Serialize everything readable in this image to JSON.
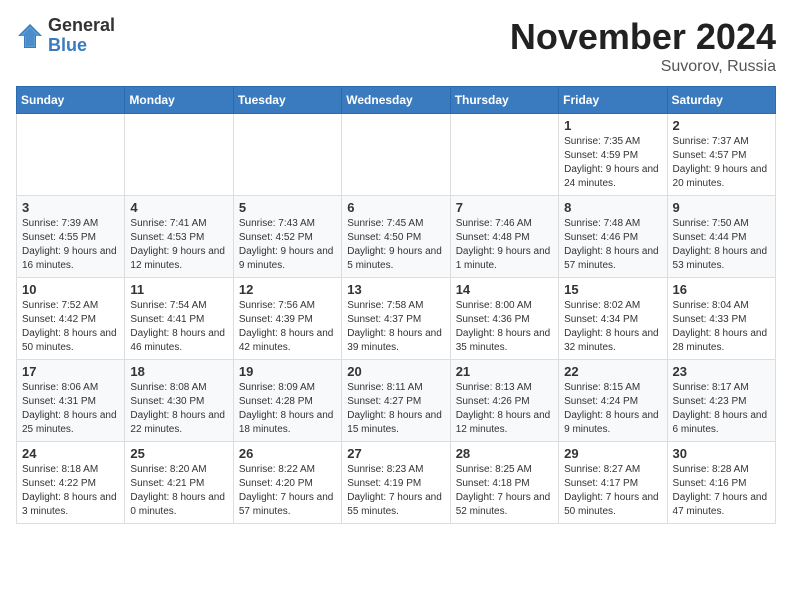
{
  "header": {
    "logo": {
      "general": "General",
      "blue": "Blue"
    },
    "title": "November 2024",
    "location": "Suvorov, Russia"
  },
  "calendar": {
    "weekdays": [
      "Sunday",
      "Monday",
      "Tuesday",
      "Wednesday",
      "Thursday",
      "Friday",
      "Saturday"
    ],
    "weeks": [
      [
        {
          "day": "",
          "info": ""
        },
        {
          "day": "",
          "info": ""
        },
        {
          "day": "",
          "info": ""
        },
        {
          "day": "",
          "info": ""
        },
        {
          "day": "",
          "info": ""
        },
        {
          "day": "1",
          "info": "Sunrise: 7:35 AM\nSunset: 4:59 PM\nDaylight: 9 hours and 24 minutes."
        },
        {
          "day": "2",
          "info": "Sunrise: 7:37 AM\nSunset: 4:57 PM\nDaylight: 9 hours and 20 minutes."
        }
      ],
      [
        {
          "day": "3",
          "info": "Sunrise: 7:39 AM\nSunset: 4:55 PM\nDaylight: 9 hours and 16 minutes."
        },
        {
          "day": "4",
          "info": "Sunrise: 7:41 AM\nSunset: 4:53 PM\nDaylight: 9 hours and 12 minutes."
        },
        {
          "day": "5",
          "info": "Sunrise: 7:43 AM\nSunset: 4:52 PM\nDaylight: 9 hours and 9 minutes."
        },
        {
          "day": "6",
          "info": "Sunrise: 7:45 AM\nSunset: 4:50 PM\nDaylight: 9 hours and 5 minutes."
        },
        {
          "day": "7",
          "info": "Sunrise: 7:46 AM\nSunset: 4:48 PM\nDaylight: 9 hours and 1 minute."
        },
        {
          "day": "8",
          "info": "Sunrise: 7:48 AM\nSunset: 4:46 PM\nDaylight: 8 hours and 57 minutes."
        },
        {
          "day": "9",
          "info": "Sunrise: 7:50 AM\nSunset: 4:44 PM\nDaylight: 8 hours and 53 minutes."
        }
      ],
      [
        {
          "day": "10",
          "info": "Sunrise: 7:52 AM\nSunset: 4:42 PM\nDaylight: 8 hours and 50 minutes."
        },
        {
          "day": "11",
          "info": "Sunrise: 7:54 AM\nSunset: 4:41 PM\nDaylight: 8 hours and 46 minutes."
        },
        {
          "day": "12",
          "info": "Sunrise: 7:56 AM\nSunset: 4:39 PM\nDaylight: 8 hours and 42 minutes."
        },
        {
          "day": "13",
          "info": "Sunrise: 7:58 AM\nSunset: 4:37 PM\nDaylight: 8 hours and 39 minutes."
        },
        {
          "day": "14",
          "info": "Sunrise: 8:00 AM\nSunset: 4:36 PM\nDaylight: 8 hours and 35 minutes."
        },
        {
          "day": "15",
          "info": "Sunrise: 8:02 AM\nSunset: 4:34 PM\nDaylight: 8 hours and 32 minutes."
        },
        {
          "day": "16",
          "info": "Sunrise: 8:04 AM\nSunset: 4:33 PM\nDaylight: 8 hours and 28 minutes."
        }
      ],
      [
        {
          "day": "17",
          "info": "Sunrise: 8:06 AM\nSunset: 4:31 PM\nDaylight: 8 hours and 25 minutes."
        },
        {
          "day": "18",
          "info": "Sunrise: 8:08 AM\nSunset: 4:30 PM\nDaylight: 8 hours and 22 minutes."
        },
        {
          "day": "19",
          "info": "Sunrise: 8:09 AM\nSunset: 4:28 PM\nDaylight: 8 hours and 18 minutes."
        },
        {
          "day": "20",
          "info": "Sunrise: 8:11 AM\nSunset: 4:27 PM\nDaylight: 8 hours and 15 minutes."
        },
        {
          "day": "21",
          "info": "Sunrise: 8:13 AM\nSunset: 4:26 PM\nDaylight: 8 hours and 12 minutes."
        },
        {
          "day": "22",
          "info": "Sunrise: 8:15 AM\nSunset: 4:24 PM\nDaylight: 8 hours and 9 minutes."
        },
        {
          "day": "23",
          "info": "Sunrise: 8:17 AM\nSunset: 4:23 PM\nDaylight: 8 hours and 6 minutes."
        }
      ],
      [
        {
          "day": "24",
          "info": "Sunrise: 8:18 AM\nSunset: 4:22 PM\nDaylight: 8 hours and 3 minutes."
        },
        {
          "day": "25",
          "info": "Sunrise: 8:20 AM\nSunset: 4:21 PM\nDaylight: 8 hours and 0 minutes."
        },
        {
          "day": "26",
          "info": "Sunrise: 8:22 AM\nSunset: 4:20 PM\nDaylight: 7 hours and 57 minutes."
        },
        {
          "day": "27",
          "info": "Sunrise: 8:23 AM\nSunset: 4:19 PM\nDaylight: 7 hours and 55 minutes."
        },
        {
          "day": "28",
          "info": "Sunrise: 8:25 AM\nSunset: 4:18 PM\nDaylight: 7 hours and 52 minutes."
        },
        {
          "day": "29",
          "info": "Sunrise: 8:27 AM\nSunset: 4:17 PM\nDaylight: 7 hours and 50 minutes."
        },
        {
          "day": "30",
          "info": "Sunrise: 8:28 AM\nSunset: 4:16 PM\nDaylight: 7 hours and 47 minutes."
        }
      ]
    ]
  }
}
